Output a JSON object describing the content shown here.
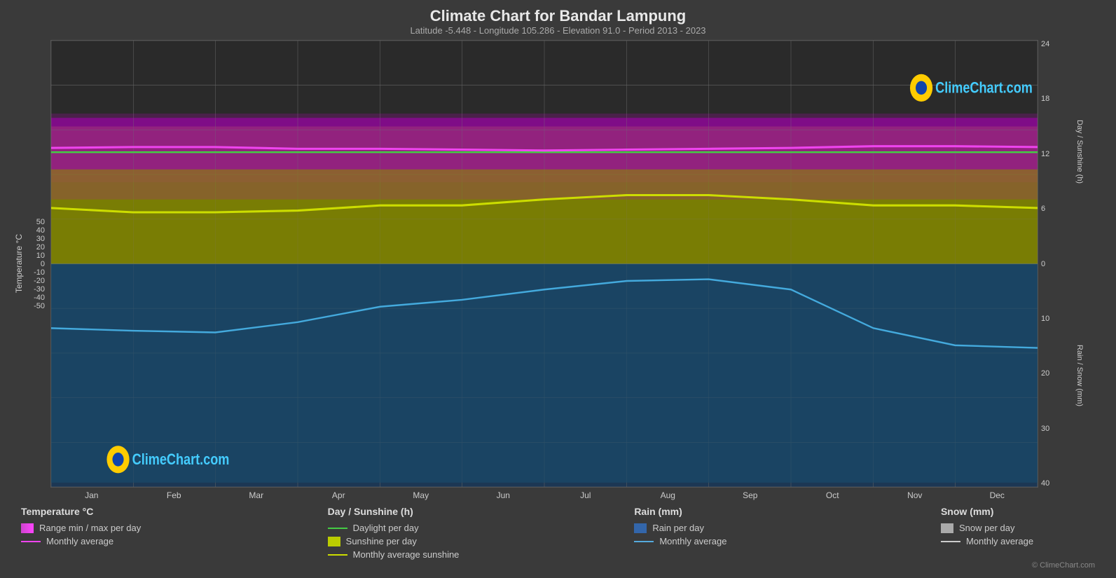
{
  "title": "Climate Chart for Bandar Lampung",
  "subtitle": "Latitude -5.448 - Longitude 105.286 - Elevation 91.0 - Period 2013 - 2023",
  "brand": "ClimeChart.com",
  "copyright": "© ClimeChart.com",
  "yaxis_left": {
    "label": "Temperature °C",
    "values": [
      "50",
      "40",
      "30",
      "20",
      "10",
      "0",
      "-10",
      "-20",
      "-30",
      "-40",
      "-50"
    ]
  },
  "yaxis_right_top": {
    "label": "Day / Sunshine (h)",
    "values": [
      "24",
      "18",
      "12",
      "6",
      "0"
    ]
  },
  "yaxis_right_bottom": {
    "label": "Rain / Snow (mm)",
    "values": [
      "0",
      "10",
      "20",
      "30",
      "40"
    ]
  },
  "xaxis": {
    "months": [
      "Jan",
      "Feb",
      "Mar",
      "Apr",
      "May",
      "Jun",
      "Jul",
      "Aug",
      "Sep",
      "Oct",
      "Nov",
      "Dec"
    ]
  },
  "legend": {
    "temperature": {
      "title": "Temperature °C",
      "items": [
        {
          "type": "swatch",
          "color": "#cc44cc",
          "label": "Range min / max per day"
        },
        {
          "type": "line",
          "color": "#dd55dd",
          "label": "Monthly average"
        }
      ]
    },
    "sunshine": {
      "title": "Day / Sunshine (h)",
      "items": [
        {
          "type": "line",
          "color": "#66cc44",
          "label": "Daylight per day"
        },
        {
          "type": "swatch",
          "color": "#bbcc00",
          "label": "Sunshine per day"
        },
        {
          "type": "line",
          "color": "#dddd00",
          "label": "Monthly average sunshine"
        }
      ]
    },
    "rain": {
      "title": "Rain (mm)",
      "items": [
        {
          "type": "swatch",
          "color": "#3366aa",
          "label": "Rain per day"
        },
        {
          "type": "line",
          "color": "#55aadd",
          "label": "Monthly average"
        }
      ]
    },
    "snow": {
      "title": "Snow (mm)",
      "items": [
        {
          "type": "swatch",
          "color": "#aaaaaa",
          "label": "Snow per day"
        },
        {
          "type": "line",
          "color": "#cccccc",
          "label": "Monthly average"
        }
      ]
    }
  }
}
